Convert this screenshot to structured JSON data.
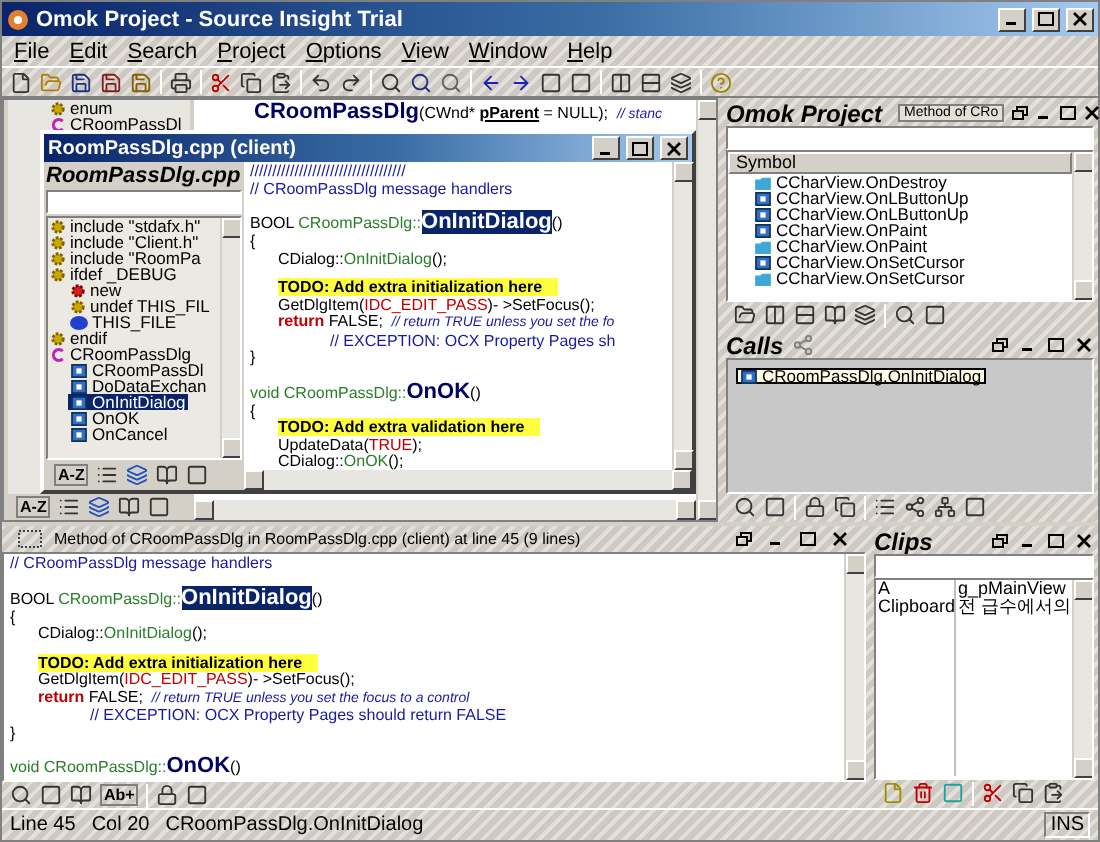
{
  "window": {
    "title": "Omok Project - Source Insight Trial"
  },
  "menu": [
    {
      "label": "File"
    },
    {
      "label": "Edit"
    },
    {
      "label": "Search"
    },
    {
      "label": "Project"
    },
    {
      "label": "Options"
    },
    {
      "label": "View"
    },
    {
      "label": "Window"
    },
    {
      "label": "Help"
    }
  ],
  "background_editor": {
    "symbols": [
      {
        "kind": "define",
        "label": "enum",
        "selected": false
      },
      {
        "kind": "class",
        "label": "CRoomPassDl",
        "selected": false
      }
    ],
    "header": [
      {
        "kind": "name",
        "text": "CRoomPassDlg"
      },
      {
        "kind": "plain",
        "text": "(CWnd* "
      },
      {
        "kind": "bold",
        "text": "pParent"
      },
      {
        "kind": "plain",
        "text": " = NULL);  "
      },
      {
        "kind": "comment",
        "text": "// stanc"
      }
    ],
    "sort_label": "A-Z"
  },
  "child_window": {
    "title": "RoomPassDlg.cpp (client)",
    "file": "RoomPassDlg.cpp",
    "sort_label": "A-Z",
    "symbols": [
      {
        "kind": "define",
        "label": "include \"stdafx.h\"",
        "selected": false
      },
      {
        "kind": "define",
        "label": "include \"Client.h\"",
        "selected": false
      },
      {
        "kind": "define",
        "label": "include \"RoomPa",
        "selected": false
      },
      {
        "kind": "define",
        "label": "ifdef _DEBUG",
        "selected": false,
        "children": [
          {
            "kind": "new",
            "label": "new",
            "selected": false
          },
          {
            "kind": "define",
            "label": "undef THIS_FIL",
            "selected": false
          },
          {
            "kind": "file",
            "label": "THIS_FILE",
            "selected": false
          }
        ]
      },
      {
        "kind": "define",
        "label": "endif",
        "selected": false
      },
      {
        "kind": "class",
        "label": "CRoomPassDlg",
        "selected": false,
        "children": [
          {
            "kind": "method",
            "label": "CRoomPassDl",
            "selected": false
          },
          {
            "kind": "method",
            "label": "DoDataExchan",
            "selected": false
          },
          {
            "kind": "method",
            "label": "OnInitDialog",
            "selected": true
          },
          {
            "kind": "method",
            "label": "OnOK",
            "selected": false
          },
          {
            "kind": "method",
            "label": "OnCancel",
            "selected": false
          }
        ]
      }
    ],
    "code": [
      {
        "kind": "top",
        "segs": [
          {
            "kind": "remark",
            "text": "///////////////////////////////////"
          }
        ]
      },
      {
        "kind": "top",
        "segs": [
          {
            "kind": "remark",
            "text": "// CRoomPassDlg message handlers"
          }
        ]
      },
      {
        "kind": "blank"
      },
      {
        "kind": "top",
        "segs": [
          {
            "kind": "plain",
            "text": "BOOL "
          },
          {
            "kind": "class",
            "text": "CRoomPassDlg::"
          },
          {
            "kind": "name-selected",
            "text": "OnInitDialog"
          },
          {
            "kind": "plain",
            "text": "()"
          }
        ]
      },
      {
        "kind": "top",
        "segs": [
          {
            "kind": "plain",
            "text": "{"
          }
        ]
      },
      {
        "kind": "body",
        "segs": [
          {
            "kind": "plain",
            "text": "CDialog::"
          },
          {
            "kind": "class",
            "text": "OnInitDialog"
          },
          {
            "kind": "plain",
            "text": "();"
          }
        ]
      },
      {
        "kind": "blank"
      },
      {
        "kind": "body",
        "segs": [
          {
            "kind": "todo",
            "text": "TODO: Add extra initialization here"
          }
        ]
      },
      {
        "kind": "body",
        "segs": [
          {
            "kind": "plain",
            "text": "GetDlgItem("
          },
          {
            "kind": "macro",
            "text": "IDC_EDIT_PASS"
          },
          {
            "kind": "plain",
            "text": ")- >SetFocus();"
          }
        ]
      },
      {
        "kind": "body",
        "segs": [
          {
            "kind": "keyword",
            "text": "return"
          },
          {
            "kind": "plain",
            "text": " FALSE;  "
          },
          {
            "kind": "comment",
            "text": "// return TRUE unless you set the fo"
          }
        ]
      },
      {
        "kind": "wrap",
        "segs": [
          {
            "kind": "remark",
            "text": "// EXCEPTION: OCX Property Pages sh"
          }
        ]
      },
      {
        "kind": "top",
        "segs": [
          {
            "kind": "plain",
            "text": "}"
          }
        ]
      },
      {
        "kind": "blank"
      },
      {
        "kind": "top",
        "segs": [
          {
            "kind": "class",
            "text": "void CRoomPassDlg::"
          },
          {
            "kind": "name",
            "text": "OnOK"
          },
          {
            "kind": "plain",
            "text": "()"
          }
        ]
      },
      {
        "kind": "top",
        "segs": [
          {
            "kind": "plain",
            "text": "{"
          }
        ]
      },
      {
        "kind": "body",
        "segs": [
          {
            "kind": "todo",
            "text": "TODO: Add extra validation here"
          }
        ]
      },
      {
        "kind": "body",
        "segs": [
          {
            "kind": "plain",
            "text": "UpdateData("
          },
          {
            "kind": "macro",
            "text": "TRUE"
          },
          {
            "kind": "plain",
            "text": ");"
          }
        ]
      },
      {
        "kind": "body",
        "segs": [
          {
            "kind": "plain",
            "text": "CDialog::"
          },
          {
            "kind": "class",
            "text": "OnOK"
          },
          {
            "kind": "plain",
            "text": "();"
          }
        ]
      }
    ]
  },
  "project_panel": {
    "title": "Omok Project",
    "tab": "Method of CRo",
    "column": "Symbol",
    "items": [
      {
        "kind": "declaration",
        "label": "CCharView.OnDestroy",
        "selected": false
      },
      {
        "kind": "method",
        "label": "CCharView.OnLButtonUp",
        "selected": false
      },
      {
        "kind": "method",
        "label": "CCharView.OnLButtonUp",
        "selected": false
      },
      {
        "kind": "method",
        "label": "CCharView.OnPaint",
        "selected": false
      },
      {
        "kind": "declaration",
        "label": "CCharView.OnPaint",
        "selected": false
      },
      {
        "kind": "method",
        "label": "CCharView.OnSetCursor",
        "selected": false
      },
      {
        "kind": "declaration",
        "label": "CCharView.OnSetCursor",
        "selected": false
      }
    ]
  },
  "calls_panel": {
    "title": "Calls",
    "items": [
      {
        "label": "CRoomPassDlg.OnInitDialog",
        "selected": true
      }
    ]
  },
  "context_window": {
    "title": "Method of CRoomPassDlg in RoomPassDlg.cpp (client) at line 45 (9 lines)",
    "tool_label": "Ab+",
    "code": [
      {
        "kind": "top",
        "segs": [
          {
            "kind": "remark",
            "text": "// CRoomPassDlg message handlers"
          }
        ]
      },
      {
        "kind": "blank"
      },
      {
        "kind": "top",
        "segs": [
          {
            "kind": "plain",
            "text": "BOOL "
          },
          {
            "kind": "class",
            "text": "CRoomPassDlg::"
          },
          {
            "kind": "name-selected",
            "text": "OnInitDialog"
          },
          {
            "kind": "plain",
            "text": "()"
          }
        ]
      },
      {
        "kind": "top",
        "segs": [
          {
            "kind": "plain",
            "text": "{"
          }
        ]
      },
      {
        "kind": "body",
        "segs": [
          {
            "kind": "plain",
            "text": "CDialog::"
          },
          {
            "kind": "class",
            "text": "OnInitDialog"
          },
          {
            "kind": "plain",
            "text": "();"
          }
        ]
      },
      {
        "kind": "blank"
      },
      {
        "kind": "body",
        "segs": [
          {
            "kind": "todo",
            "text": "TODO: Add extra initialization here"
          }
        ]
      },
      {
        "kind": "body",
        "segs": [
          {
            "kind": "plain",
            "text": "GetDlgItem("
          },
          {
            "kind": "macro",
            "text": "IDC_EDIT_PASS"
          },
          {
            "kind": "plain",
            "text": ")- >SetFocus();"
          }
        ]
      },
      {
        "kind": "body",
        "segs": [
          {
            "kind": "keyword",
            "text": "return"
          },
          {
            "kind": "plain",
            "text": " FALSE;  "
          },
          {
            "kind": "comment",
            "text": "// return TRUE unless you set the focus to a control"
          }
        ]
      },
      {
        "kind": "wrap",
        "segs": [
          {
            "kind": "remark",
            "text": "// EXCEPTION: OCX Property Pages should return FALSE"
          }
        ]
      },
      {
        "kind": "top",
        "segs": [
          {
            "kind": "plain",
            "text": "}"
          }
        ]
      },
      {
        "kind": "blank"
      },
      {
        "kind": "top",
        "segs": [
          {
            "kind": "class",
            "text": "void CRoomPassDlg::"
          },
          {
            "kind": "name",
            "text": "OnOK"
          },
          {
            "kind": "plain",
            "text": "()"
          }
        ]
      }
    ]
  },
  "clips_panel": {
    "title": "Clips",
    "rows": [
      [
        "A",
        "g_pMainView"
      ],
      [
        "Clipboard",
        "전 급수에서의"
      ]
    ]
  },
  "status_bar": {
    "line": "Line 45",
    "column": "Col 20",
    "symbol": "CRoomPassDlg.OnInitDialog",
    "mode": "INS"
  }
}
